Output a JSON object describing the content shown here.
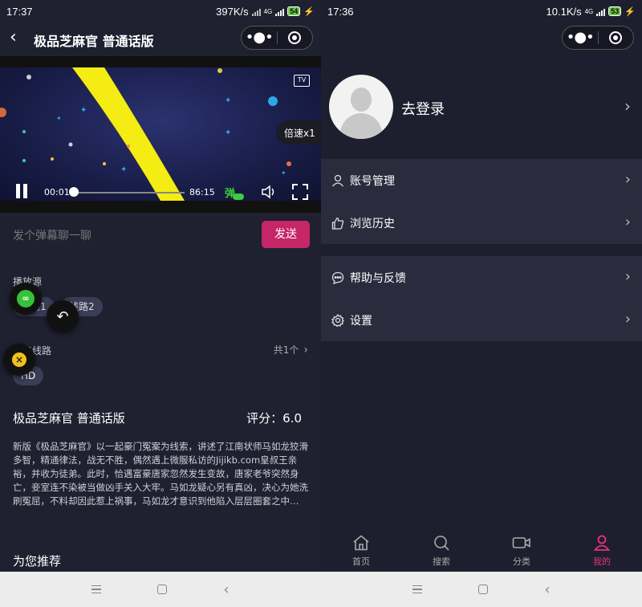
{
  "left": {
    "status": {
      "time": "17:37",
      "speed": "397K/s",
      "network": "4G",
      "battery": "54"
    },
    "header": {
      "back_icon": "‹",
      "title": "极品芝麻官 普通话版"
    },
    "video": {
      "current_time": "00:01",
      "total_time": "86:15",
      "speed_label": "倍速x1",
      "progress": 0.01,
      "danmu_label": "弹"
    },
    "danmu": {
      "placeholder": "发个弹幕聊一聊",
      "send_label": "发送"
    },
    "sources": {
      "label": "播放源",
      "items": [
        "线路1",
        "线路2"
      ]
    },
    "switch": {
      "label": "切换线路",
      "count": "共1个",
      "items": [
        "HD"
      ]
    },
    "movie": {
      "title": "极品芝麻官 普通话版",
      "rating": "评分：6.0",
      "description": "新版《极品芝麻官》以一起豪门冤案为线索，讲述了江南状师马如龙狡滑多智，精通律法，战无不胜，偶然遇上微服私访的Jijikb.com皇叔王亲裕，并收为徒弟。此时，恰遇富豪唐家忽然发生变故，唐家老爷突然身亡，妾室连不染被当做凶手关入大牢。马如龙疑心另有真凶，决心为她洗刷冤屈，不料却因此惹上祸事，马如龙才意识到他陷入层层圈套之中…"
    },
    "recommend_title": "为您推荐"
  },
  "right": {
    "status": {
      "time": "17:36",
      "speed": "10.1K/s",
      "network": "4G",
      "battery": "53"
    },
    "profile": {
      "login_label": "去登录"
    },
    "menu_group_1": [
      {
        "label": "账号管理",
        "icon": "user-icon"
      },
      {
        "label": "浏览历史",
        "icon": "thumbs-up-icon"
      }
    ],
    "menu_group_2": [
      {
        "label": "帮助与反馈",
        "icon": "chat-bubble-icon"
      },
      {
        "label": "设置",
        "icon": "gear-icon"
      }
    ],
    "tabs": [
      {
        "label": "首页",
        "icon": "home-icon"
      },
      {
        "label": "搜索",
        "icon": "search-icon"
      },
      {
        "label": "分类",
        "icon": "video-camera-icon"
      },
      {
        "label": "我的",
        "icon": "person-icon"
      }
    ],
    "active_tab": "我的"
  },
  "colors": {
    "accent": "#c52667",
    "active_tab": "#e8327c",
    "bg": "#1f2030",
    "panel": "#2a2c3e",
    "chip": "#3a3d55"
  }
}
